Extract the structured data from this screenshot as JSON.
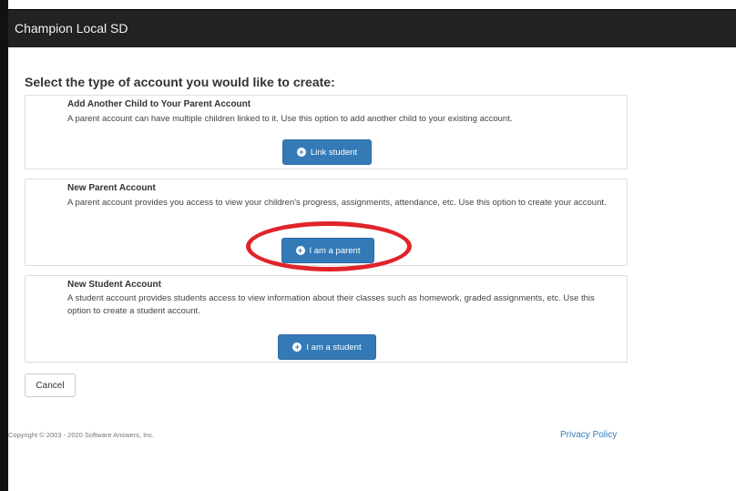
{
  "navbar": {
    "brand": "Champion Local SD"
  },
  "page": {
    "heading": "Select the type of account you would like to create:"
  },
  "panels": [
    {
      "title": "Add Another Child to Your Parent Account",
      "description": "A parent account can have multiple children linked to it. Use this option to add another child to your existing account.",
      "button_label": "Link student",
      "button_icon": "plus-circle-icon"
    },
    {
      "title": "New Parent Account",
      "description": "A parent account provides you access to view your children's progress, assignments, attendance, etc. Use this option to create your account.",
      "button_label": "I am a parent",
      "button_icon": "plus-circle-icon"
    },
    {
      "title": "New Student Account",
      "description": "A student account provides students access to view information about their classes such as homework, graded assignments, etc. Use this option to create a student account.",
      "button_label": "I am a student",
      "button_icon": "plus-circle-icon"
    }
  ],
  "actions": {
    "cancel_label": "Cancel"
  },
  "footer": {
    "copyright": "Copyright © 2003 - 2020 Software Answers, Inc.",
    "privacy_label": "Privacy Policy"
  },
  "colors": {
    "navbar_bg": "#222222",
    "primary_button": "#337ab7",
    "highlight_ring": "#e0232a",
    "link": "#337ab7"
  }
}
